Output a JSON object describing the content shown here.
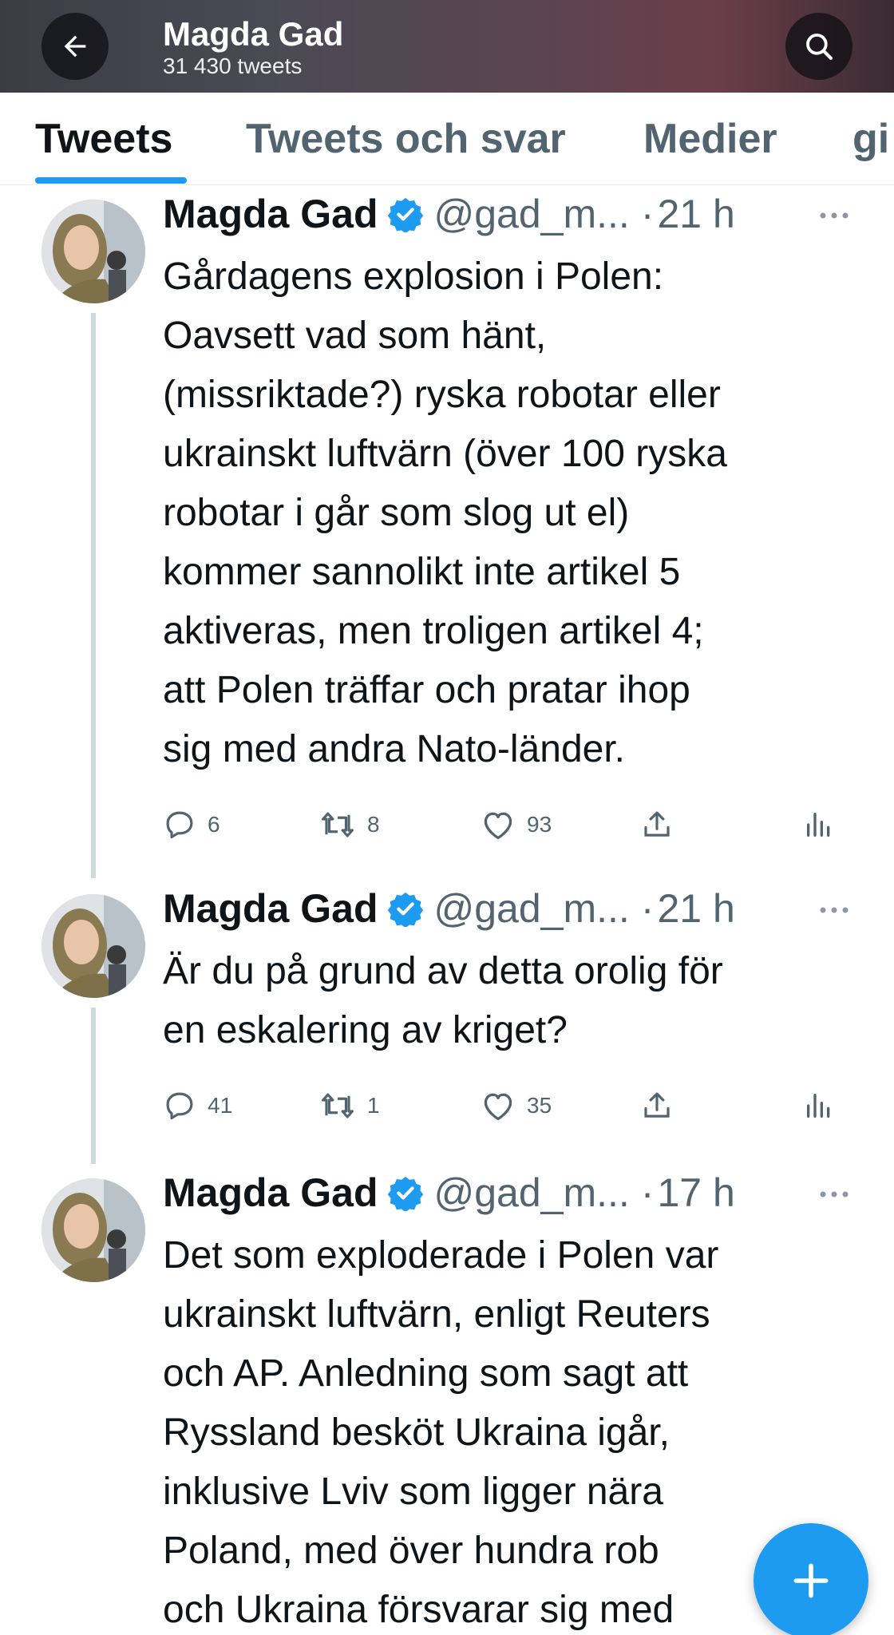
{
  "header": {
    "title": "Magda Gad",
    "subtitle": "31 430 tweets",
    "back_icon": "arrow-left-icon",
    "search_icon": "search-icon"
  },
  "tabs": [
    {
      "label": "Tweets",
      "active": true
    },
    {
      "label": "Tweets och svar",
      "active": false
    },
    {
      "label": "Medier",
      "active": false
    },
    {
      "label": "gi",
      "active": false
    }
  ],
  "colors": {
    "accent": "#1d9bf0",
    "text": "#0f1419",
    "muted": "#536471"
  },
  "tweets": [
    {
      "name": "Magda Gad",
      "handle": "@gad_m...",
      "time": "21 h",
      "text": "Gårdagens explosion i Polen:\nOavsett vad som hänt,\n(missriktade?) ryska robotar eller\nukrainskt luftvärn (över 100 ryska\nrobotar i går som slog ut el)\nkommer sannolikt inte artikel 5\naktiveras, men troligen artikel 4;\natt Polen träffar och pratar ihop\nsig med andra Nato-länder.",
      "replies": "6",
      "retweets": "8",
      "likes": "93"
    },
    {
      "name": "Magda Gad",
      "handle": "@gad_m...",
      "time": "21 h",
      "text": "Är du på grund av detta orolig för\nen eskalering av kriget?",
      "replies": "41",
      "retweets": "1",
      "likes": "35"
    },
    {
      "name": "Magda Gad",
      "handle": "@gad_m...",
      "time": "17 h",
      "text": "Det som exploderade i Polen var\nukrainskt luftvärn, enligt Reuters\noch AP. Anledning som sagt att\nRyssland besköt Ukraina igår,\ninklusive Lviv som ligger nära\nPoland, med över hundra rob\noch Ukraina försvarar sig med"
    }
  ],
  "fab": {
    "icon": "compose-plus-icon"
  }
}
